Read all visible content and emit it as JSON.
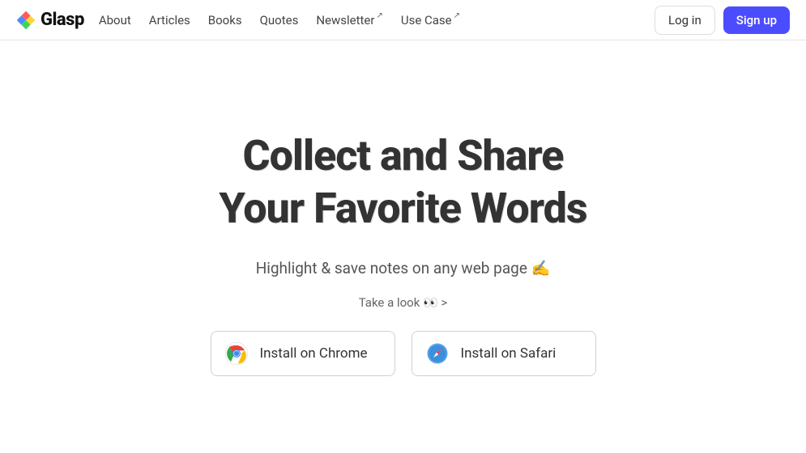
{
  "brand": "Glasp",
  "nav": {
    "about": "About",
    "articles": "Articles",
    "books": "Books",
    "quotes": "Quotes",
    "newsletter": "Newsletter",
    "usecase": "Use Case"
  },
  "auth": {
    "login": "Log in",
    "signup": "Sign up"
  },
  "hero": {
    "headline": "Collect and Share\nYour Favorite Words",
    "subhead": "Highlight & save notes on any web page ✍️",
    "takeLook": "Take a look 👀 >"
  },
  "install": {
    "chrome": "Install on Chrome",
    "safari": "Install on Safari"
  }
}
